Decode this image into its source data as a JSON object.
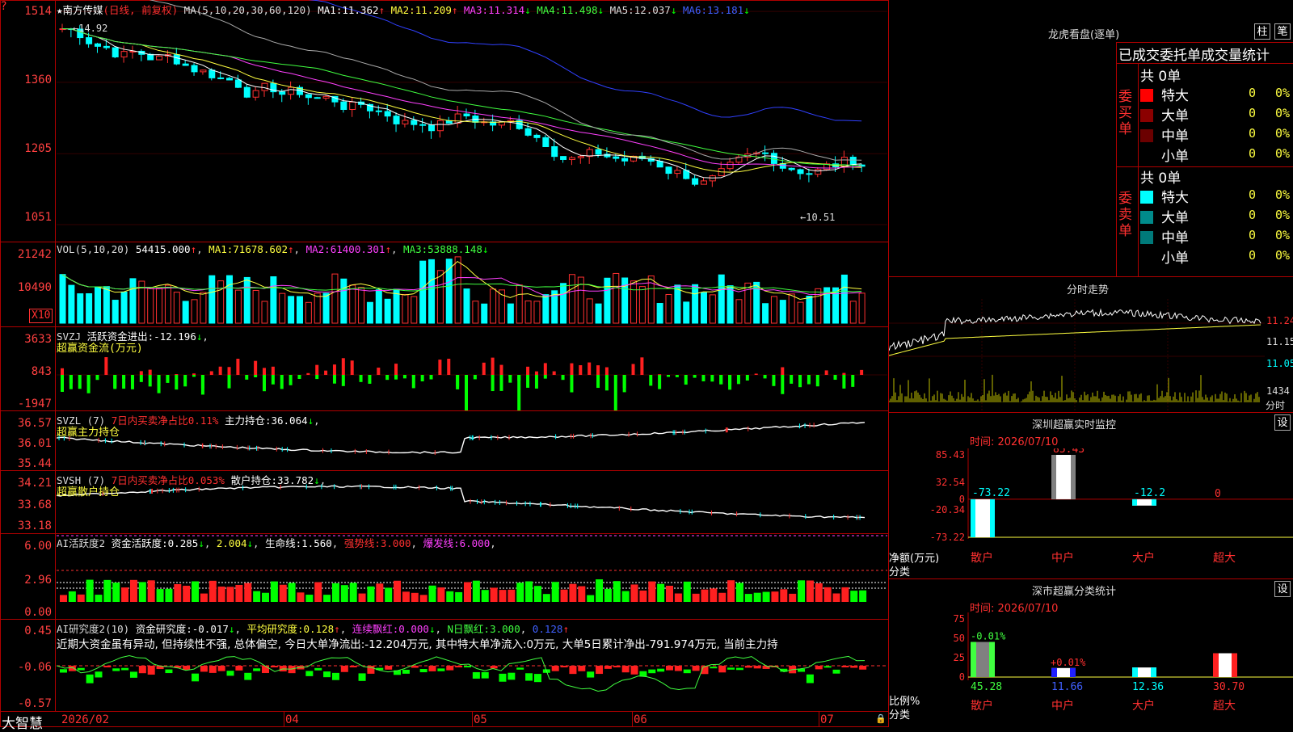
{
  "app": {
    "brand": "大智慧"
  },
  "stock": {
    "title": "★南方传媒",
    "mode": "(日线, 前复权)",
    "ma_params": "MA(5,10,20,30,60,120)",
    "ma1_label": "MA1:",
    "ma1": "11.362",
    "ma2_label": "MA2:",
    "ma2": "11.209",
    "ma3_label": "MA3:",
    "ma3": "11.314",
    "ma4_label": "MA4:",
    "ma4": "11.498",
    "ma5_label": "MA5:",
    "ma5": "12.037",
    "ma6_label": "MA6:",
    "ma6": "13.181",
    "up_arrow": "↑",
    "down_arrow": "↓",
    "high_mark": "←14.92",
    "low_mark": "←10.51",
    "y_ticks": [
      "1514",
      "1360",
      "1205",
      "1051"
    ]
  },
  "volume": {
    "params": "VOL(5,10,20)",
    "value": "54415.000",
    "ma1_label": "MA1:",
    "ma1": "71678.602",
    "ma2_label": "MA2:",
    "ma2": "61400.301",
    "ma3_label": "MA3:",
    "ma3": "53888.148",
    "y_ticks": [
      "21242",
      "10490"
    ],
    "unit": "X10"
  },
  "svzj": {
    "name": "SVZJ",
    "label": "活跃资金进出:",
    "value": "-12.196",
    "subtitle": "超赢资金流(万元)",
    "y_ticks": [
      "3633",
      "843",
      "-1947"
    ]
  },
  "svzl": {
    "name": "SVZL (7)",
    "note": "7日内买卖净占比0.11%",
    "label": "主力持仓:",
    "value": "36.064",
    "subtitle": "超赢主力持仓",
    "y_ticks": [
      "36.57",
      "36.01",
      "35.44"
    ]
  },
  "svsh": {
    "name": "SVSH (7)",
    "note": "7日内买卖净占比0.053%",
    "label": "散户持仓:",
    "value": "33.782",
    "subtitle": "超赢散户持仓",
    "y_ticks": [
      "34.21",
      "33.68",
      "33.18"
    ]
  },
  "ai_active": {
    "name": "AI活跃度2",
    "label": "资金活跃度:",
    "value": "0.285",
    "v2": "2.004",
    "life_label": "生命线:",
    "life": "1.560",
    "strong_label": "强势线:",
    "strong": "3.000",
    "burst_label": "爆发线:",
    "burst": "6.000",
    "y_ticks": [
      "6.00",
      "2.96",
      "0.00"
    ]
  },
  "ai_research": {
    "name": "AI研究度2(10)",
    "label": "资金研究度:",
    "value": "-0.017",
    "avg_label": "平均研究度:",
    "avg": "0.128",
    "red_label": "连续飘红:",
    "red": "0.000",
    "n_label": "N日飘红:",
    "n": "3.000",
    "n2": "0.128",
    "commentary": "近期大资金虽有异动, 但持续性不强, 总体偏空, 今日大单净流出:-12.204万元, 其中特大单净流入:0万元, 大单5日累计净出-791.974万元, 当前主力持",
    "y_ticks": [
      "0.45",
      "-0.06",
      "-0.57"
    ]
  },
  "dates": [
    "2026/02",
    "04",
    "05",
    "06",
    "07"
  ],
  "dragon": {
    "title": "龙虎看盘(逐单)",
    "btn_bar": "柱",
    "btn_pen": "笔",
    "subtitle": "已成交委托单成交量统计",
    "buy_label": "委买单",
    "sell_label": "委卖单",
    "buy_total": "共 0单",
    "sell_total": "共 0单",
    "buy_rows": [
      {
        "name": "特大",
        "count": "0",
        "pct": "0%",
        "color": "#ff0000"
      },
      {
        "name": "大单",
        "count": "0",
        "pct": "0%",
        "color": "#8b0000"
      },
      {
        "name": "中单",
        "count": "0",
        "pct": "0%",
        "color": "#6b0000"
      },
      {
        "name": "小单",
        "count": "0",
        "pct": "0%",
        "color": "#000000"
      }
    ],
    "sell_rows": [
      {
        "name": "特大",
        "count": "0",
        "pct": "0%",
        "color": "#00ffff"
      },
      {
        "name": "大单",
        "count": "0",
        "pct": "0%",
        "color": "#008b8b"
      },
      {
        "name": "中单",
        "count": "0",
        "pct": "0%",
        "color": "#007a7a"
      },
      {
        "name": "小单",
        "count": "0",
        "pct": "0%",
        "color": "#000000"
      }
    ]
  },
  "intraday": {
    "title": "分时走势",
    "prices": [
      "11.24",
      "11.15",
      "11.05"
    ],
    "vol": "1434",
    "vol_unit": "分时"
  },
  "sz_monitor": {
    "title": "深圳超赢实时监控",
    "settings": "设",
    "time": "时间: 2026/07/10",
    "y_ticks": [
      "85.43",
      "32.54",
      "0",
      "-20.34",
      "-73.22"
    ],
    "axis_label": "净额(万元)",
    "cat_label": "分类",
    "categories": [
      "散户",
      "中户",
      "大户",
      "超大"
    ],
    "values": [
      -73.22,
      85.43,
      -12.2,
      0
    ],
    "value_labels": [
      "-73.22",
      "85.43",
      "-12.2",
      "0"
    ]
  },
  "sz_class": {
    "title": "深市超赢分类统计",
    "settings": "设",
    "time": "时间: 2026/07/10",
    "y_ticks": [
      "75",
      "50",
      "25",
      "0"
    ],
    "axis_label": "比例%",
    "cat_label": "分类",
    "categories": [
      "散户",
      "中户",
      "大户",
      "超大"
    ],
    "values": [
      45.28,
      11.66,
      12.36,
      30.7
    ],
    "value_labels": [
      "45.28",
      "11.66",
      "12.36",
      "30.70"
    ],
    "delta_labels": [
      "-0.01%",
      "+0.01%"
    ]
  }
}
